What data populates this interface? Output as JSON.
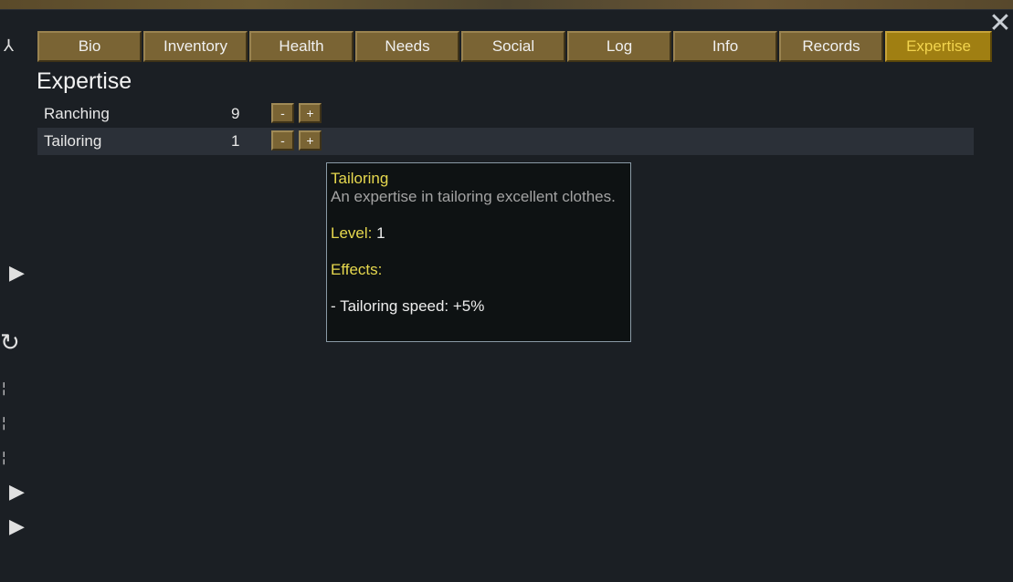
{
  "window": {
    "close_icon": "close-x-icon"
  },
  "tabs": [
    {
      "label": "Bio"
    },
    {
      "label": "Inventory"
    },
    {
      "label": "Health"
    },
    {
      "label": "Needs"
    },
    {
      "label": "Social"
    },
    {
      "label": "Log"
    },
    {
      "label": "Info"
    },
    {
      "label": "Records"
    },
    {
      "label": "Expertise",
      "active": true
    }
  ],
  "page": {
    "title": "Expertise"
  },
  "expertise": [
    {
      "name": "Ranching",
      "level": "9",
      "minus": "-",
      "plus": "+"
    },
    {
      "name": "Tailoring",
      "level": "1",
      "minus": "-",
      "plus": "+"
    }
  ],
  "tooltip": {
    "title": "Tailoring",
    "description": "An expertise in tailoring excellent clothes.",
    "level_label": "Level:",
    "level_value": " 1",
    "effects_label": "Effects:",
    "effect_1": "- Tailoring speed: +5%"
  },
  "colors": {
    "background": "#1b1f24",
    "tab": "#7a6434",
    "tab_active": "#a07f12",
    "tab_active_text": "#f2d44e",
    "tooltip_highlight": "#e6d84e"
  }
}
